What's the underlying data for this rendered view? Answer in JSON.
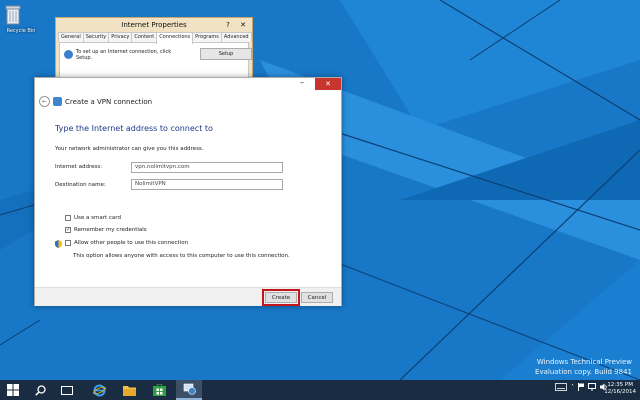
{
  "desktop": {
    "recycle_bin_label": "Recycle Bin"
  },
  "internet_properties": {
    "title": "Internet Properties",
    "help_label": "?",
    "close_label": "✕",
    "tabs": [
      "General",
      "Security",
      "Privacy",
      "Content",
      "Connections",
      "Programs",
      "Advanced"
    ],
    "active_tab": "Connections",
    "setup_text": "To set up an Internet connection, click Setup.",
    "setup_button": "Setup"
  },
  "vpn_dialog": {
    "minimize_label": "–",
    "close_label": "✕",
    "window_title": "Create a VPN connection",
    "heading": "Type the Internet address to connect to",
    "subtext": "Your network administrator can give you this address.",
    "internet_address_label": "Internet address:",
    "internet_address_value": "vpn.nolimitvpn.com",
    "destination_name_label": "Destination name:",
    "destination_name_value": "NolimitVPN",
    "use_smart_card_label": "Use a smart card",
    "use_smart_card_checked": false,
    "remember_credentials_label": "Remember my credentials",
    "remember_credentials_checked": true,
    "allow_others_label": "Allow other people to use this connection",
    "allow_others_checked": false,
    "allow_others_note": "This option allows anyone with access to this computer to use this connection.",
    "create_button": "Create",
    "cancel_button": "Cancel"
  },
  "watermark": {
    "line1": "Windows Technical Preview",
    "line2": "Evaluation copy. Build 9841"
  },
  "taskbar": {
    "time": "12:35 PM",
    "date": "12/16/2014"
  },
  "colors": {
    "desktop_blue": "#1877c7",
    "taskbar": "#1a2c42",
    "close_red": "#c7352c",
    "highlight_red": "#c4151c",
    "heading_blue": "#1e3a8a"
  }
}
